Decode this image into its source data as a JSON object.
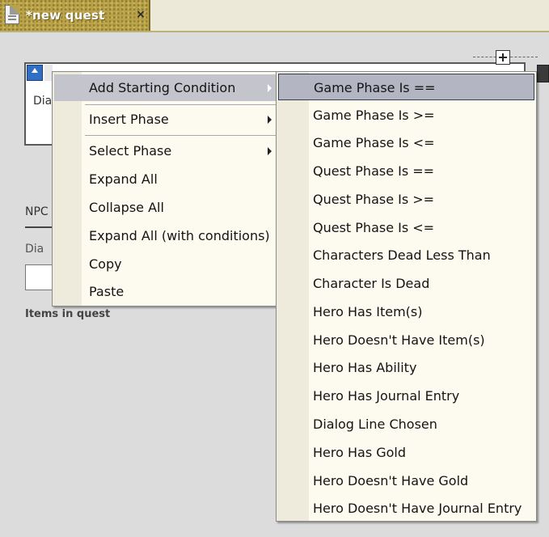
{
  "tab": {
    "title": "*new quest",
    "close_glyph": "×",
    "doc_icon": "document-icon"
  },
  "panel": {
    "item_text": "Dia",
    "npc_label": "NPC",
    "dialog_label": "Dia",
    "items_label": "Items in quest",
    "expand_icon": "plus-box-icon",
    "node_icon": "phase-node-icon"
  },
  "context_menu": {
    "items": [
      {
        "label": "Add Starting Condition",
        "submenu": true,
        "active": true
      },
      {
        "label": "Insert Phase",
        "submenu": true
      },
      {
        "label": "Select Phase",
        "submenu": true
      },
      {
        "label": "Expand All"
      },
      {
        "label": "Collapse All"
      },
      {
        "label": "Expand All (with conditions)"
      },
      {
        "label": "Copy"
      },
      {
        "label": "Paste"
      }
    ],
    "arrow_icon": "chevron-right-icon"
  },
  "submenu": {
    "items": [
      {
        "label": "Game Phase Is ==",
        "active": true
      },
      {
        "label": "Game Phase Is >="
      },
      {
        "label": "Game Phase Is <="
      },
      {
        "label": "Quest Phase Is =="
      },
      {
        "label": "Quest Phase Is >="
      },
      {
        "label": "Quest Phase Is <="
      },
      {
        "label": "Characters Dead Less Than"
      },
      {
        "label": "Character Is Dead"
      },
      {
        "label": "Hero Has Item(s)"
      },
      {
        "label": "Hero Doesn't Have Item(s)"
      },
      {
        "label": "Hero Has Ability"
      },
      {
        "label": "Hero Has Journal Entry"
      },
      {
        "label": "Dialog Line Chosen"
      },
      {
        "label": "Hero Has Gold"
      },
      {
        "label": "Hero Doesn't Have Gold"
      },
      {
        "label": "Hero Doesn't Have Journal Entry"
      }
    ]
  }
}
